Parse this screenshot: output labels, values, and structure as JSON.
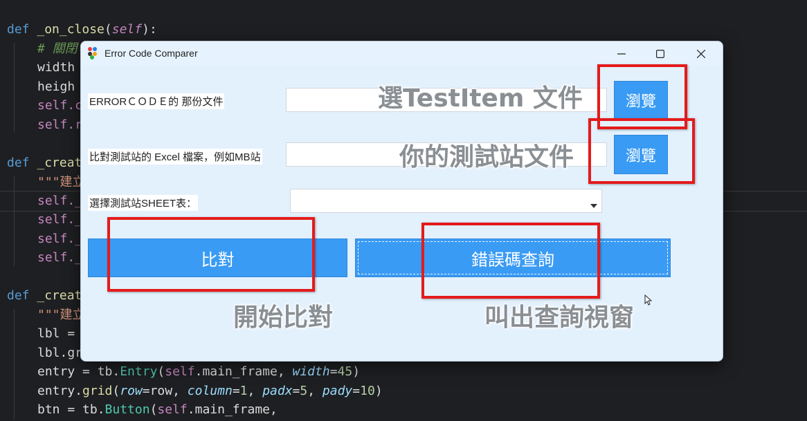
{
  "window": {
    "title": "Error Code Comparer",
    "minimize_icon": "minimize-icon",
    "maximize_icon": "maximize-icon",
    "close_icon": "close-icon"
  },
  "form": {
    "row1_label": "ERRORＣＯＤＥ的 那份文件",
    "row2_label": "比對測試站的 Excel 檔案，例如MB站",
    "row3_label": "選擇測試站SHEET表：",
    "row1_value": "",
    "row2_value": "",
    "row3_selected": "",
    "browse1_label": "瀏覽",
    "browse2_label": "瀏覽"
  },
  "actions": {
    "compare_label": "比對",
    "lookup_label": "錯誤碼查詢"
  },
  "annotations": {
    "browse1": "選TestItem 文件",
    "browse2": "你的測試站文件",
    "compare": "開始比對",
    "lookup": "叫出查詢視窗"
  },
  "code": {
    "l1_kw": "def",
    "l1_fn": "_on_close",
    "l1_self": "self",
    "l2": "# 關閉",
    "l3": "width",
    "l4": "heigh",
    "l5": "self.c",
    "l6": "self.r",
    "l7_kw": "def",
    "l7_fn": "_creat",
    "l8": "\"\"\"建立",
    "l9": "self._",
    "l10": "self._",
    "l11": "self._",
    "l12": "self._",
    "l13_kw": "def",
    "l13_fn": "_creat",
    "l14": "\"\"\"建立",
    "l15": "lbl = ",
    "l16": "lbl.gr",
    "l17a": "entry = tb.",
    "l17b": "Entry",
    "l17c": "(",
    "l17d": "self",
    "l17e": ".main_frame, ",
    "l17f": "width",
    "l17g": "=",
    "l17h": "45",
    "l17i": ")",
    "l18a": "entry.",
    "l18b": "grid",
    "l18c": "(",
    "l18d": "row",
    "l18e": "=row, ",
    "l18f": "column",
    "l18g": "=",
    "l18h": "1",
    "l18i": ", ",
    "l18j": "padx",
    "l18k": "=",
    "l18l": "5",
    "l18m": ", ",
    "l18n": "pady",
    "l18o": "=",
    "l18p": "10",
    "l18q": ")",
    "l19a": "btn = tb.",
    "l19b": "Button",
    "l19c": "(",
    "l19d": "self",
    "l19e": ".main_frame,"
  },
  "colors": {
    "button_blue": "#3a9bf4",
    "annotation_red": "#e41b1b",
    "window_bg": "#e3f1fd"
  }
}
